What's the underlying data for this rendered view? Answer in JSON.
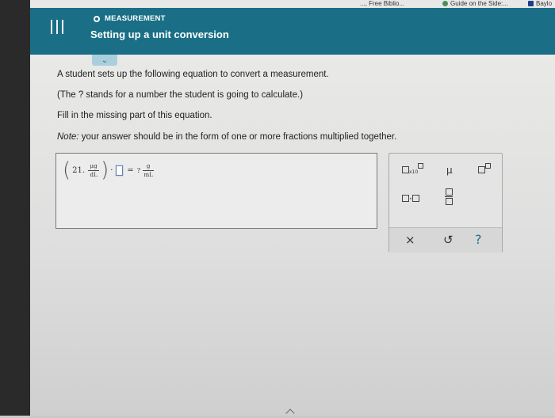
{
  "bookmarks": [
    {
      "label": "..., Free Biblio...",
      "icon": "bookmark-page-icon"
    },
    {
      "label": "Guide on the Side:...",
      "icon": "globe-icon"
    },
    {
      "label": "Baylo",
      "icon": "bookmark-square-icon"
    }
  ],
  "header": {
    "topic": "MEASUREMENT",
    "title": "Setting up a unit conversion",
    "menu_icon": "hamburger-menu-icon",
    "status_icon": "circle-status-icon"
  },
  "question": {
    "line1": "A student sets up the following equation to convert a measurement.",
    "line2": "(The ? stands for a number the student is going to calculate.)",
    "line3": "Fill in the missing part of this equation.",
    "note_label": "Note:",
    "note_text": " your answer should be in the form of one or more fractions multiplied together."
  },
  "equation": {
    "coefficient": "21.",
    "unit_num": "μg",
    "unit_den": "dL",
    "multiply": "·",
    "equals": "=",
    "unknown": "?",
    "result_num": "g",
    "result_den": "mL"
  },
  "toolbar": {
    "sci_notation_label": "x10",
    "mu_label": "μ",
    "dot_label": "·",
    "clear_label": "×",
    "undo_label": "↺",
    "help_label": "?"
  },
  "colors": {
    "header_bg": "#1a6e86",
    "chevron_bg": "#aacfdc",
    "help_color": "#1f6f85"
  }
}
